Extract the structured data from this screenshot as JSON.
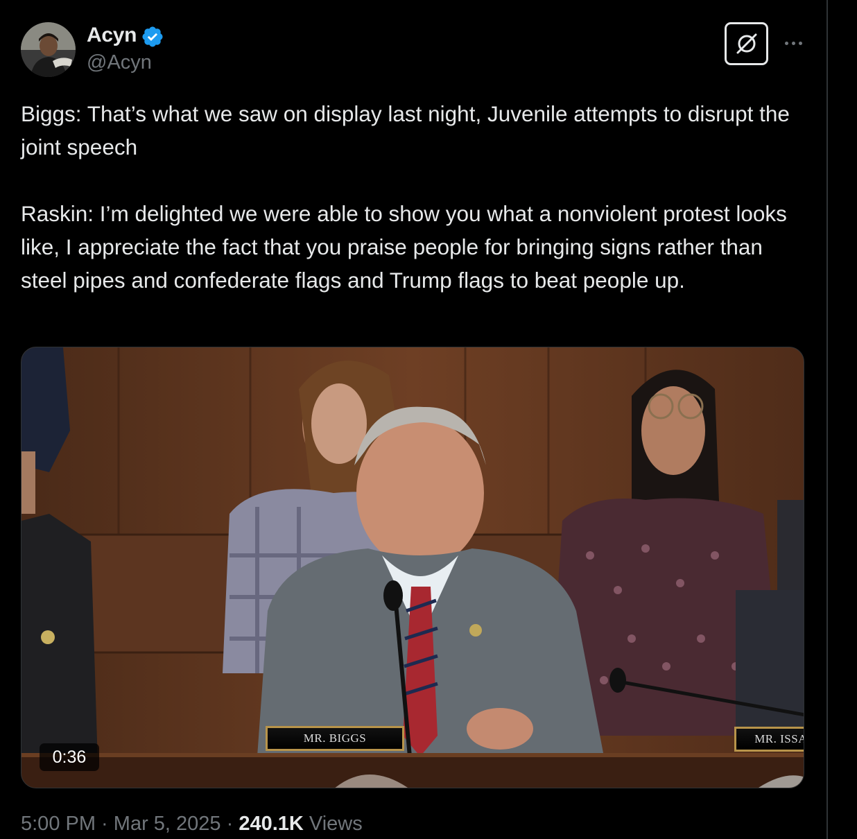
{
  "tweet": {
    "author": {
      "display_name": "Acyn",
      "handle": "@Acyn",
      "verified": true,
      "verified_color": "#1d9bf0"
    },
    "text_paragraphs": [
      "Biggs: That’s what we saw on display last night, Juvenile attempts to disrupt the joint speech",
      "Raskin: I’m delighted we were able to show you what a nonviolent protest looks like, I appreciate the fact that you praise people for bringing signs rather than steel pipes and confederate flags and Trump flags to beat people up."
    ],
    "media": {
      "type": "video",
      "duration": "0:36",
      "nameplates": [
        "MR. BIGGS",
        "MR. ISSA"
      ]
    },
    "meta": {
      "time": "5:00 PM",
      "separator": " · ",
      "date": "Mar 5, 2025",
      "views_count": "240.1K",
      "views_label": "Views"
    },
    "icons": {
      "grok": "grok-icon",
      "more": "more-icon",
      "verified": "verified-badge-icon"
    }
  },
  "colors": {
    "background": "#000000",
    "text_primary": "#e7e9ea",
    "text_secondary": "#71767b",
    "border": "#2f3336"
  }
}
